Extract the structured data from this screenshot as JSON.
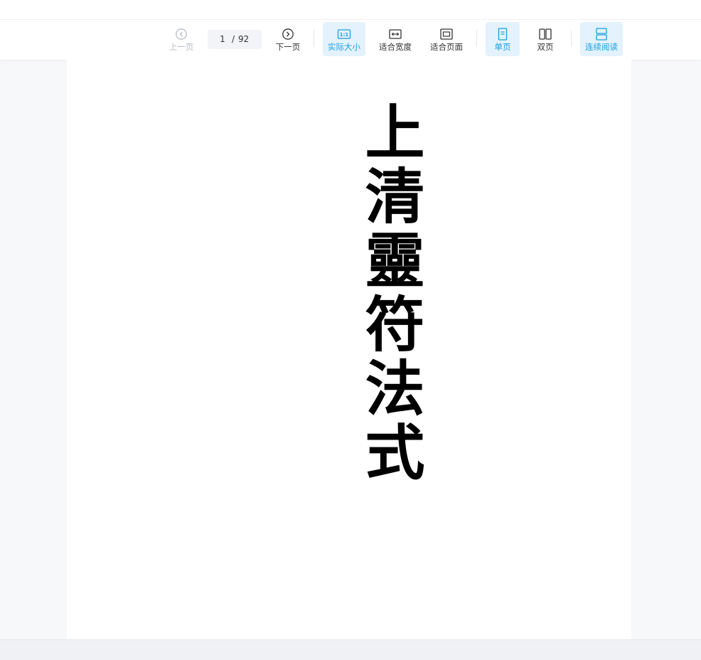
{
  "toolbar": {
    "prev_label": "上一页",
    "page_current": "1",
    "page_separator": "/",
    "page_total": "92",
    "next_label": "下一页",
    "actual_size_label": "实际大小",
    "actual_size_icon_text": "1:1",
    "fit_width_label": "适合宽度",
    "fit_page_label": "适合页面",
    "single_page_label": "单页",
    "double_page_label": "双页",
    "continuous_label": "连续阅读"
  },
  "document": {
    "title": "上清靈符法式"
  },
  "colors": {
    "accent": "#1a9fe0",
    "active_bg": "#e3f2fd",
    "disabled": "#b6bcc4",
    "viewer_bg": "#f7f8fa"
  }
}
